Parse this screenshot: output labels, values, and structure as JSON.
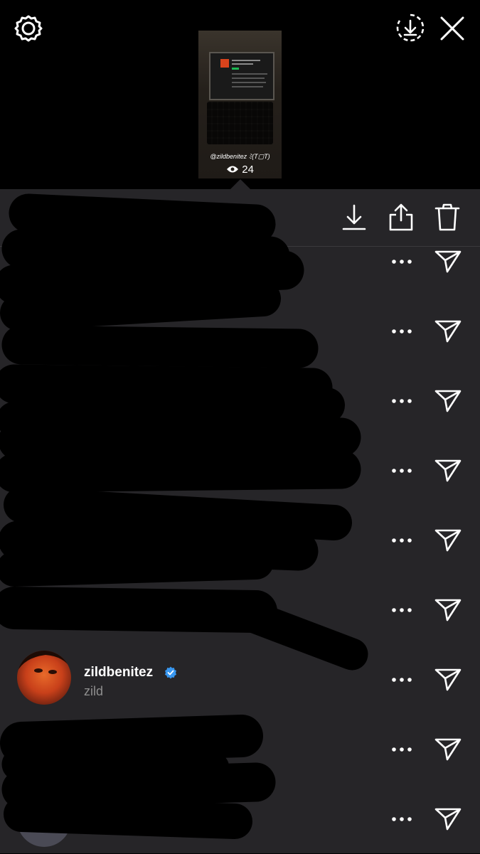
{
  "header": {
    "settings_icon": "gear-icon",
    "save_icon": "download-circle-icon",
    "close_icon": "close-icon"
  },
  "story": {
    "tag_text": "@zildbenitez",
    "tag_emoticon": "ﾐ(T▢T)",
    "view_count": "24",
    "views_icon": "eye-icon"
  },
  "actions": {
    "download_icon": "download-icon",
    "share_icon": "share-icon",
    "delete_icon": "trash-icon"
  },
  "viewers": [
    {
      "username": "",
      "name": "",
      "redacted": true
    },
    {
      "username": "",
      "name": "",
      "redacted": true
    },
    {
      "username": "",
      "name": "",
      "redacted": true
    },
    {
      "username": "",
      "name": "",
      "redacted": true
    },
    {
      "username": "",
      "name": "",
      "redacted": true
    },
    {
      "username": "",
      "name": "",
      "redacted": true
    },
    {
      "username": "zildbenitez",
      "name": "zild",
      "verified": true,
      "redacted": false
    },
    {
      "username": "",
      "name": "",
      "redacted": true
    },
    {
      "username": "",
      "name": "",
      "redacted": true
    }
  ],
  "colors": {
    "sheet_bg": "#262528",
    "verified_blue": "#3897f0",
    "secondary_text": "#8e8e8e"
  }
}
